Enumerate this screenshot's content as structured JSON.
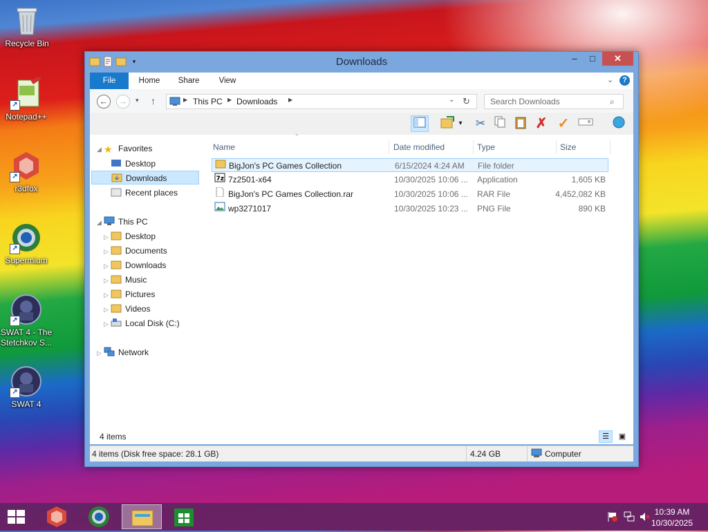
{
  "desktop": {
    "icons": [
      {
        "label": "Recycle Bin"
      },
      {
        "label": "Notepad++"
      },
      {
        "label": "r3dfox"
      },
      {
        "label": "Supermium"
      },
      {
        "label": "SWAT 4 - The Stetchkov S..."
      },
      {
        "label": "SWAT 4"
      }
    ]
  },
  "window": {
    "title": "Downloads",
    "buttons": {
      "minimize": "–",
      "maximize": "□",
      "close": "✕"
    }
  },
  "ribbon": {
    "tabs": [
      "File",
      "Home",
      "Share",
      "View"
    ]
  },
  "address": {
    "crumbs": [
      "This PC",
      "Downloads"
    ],
    "search_placeholder": "Search Downloads"
  },
  "nav": {
    "favorites_label": "Favorites",
    "favorites": [
      "Desktop",
      "Downloads",
      "Recent places"
    ],
    "thispc_label": "This PC",
    "thispc": [
      "Desktop",
      "Documents",
      "Downloads",
      "Music",
      "Pictures",
      "Videos",
      "Local Disk (C:)"
    ],
    "network_label": "Network"
  },
  "columns": [
    "Name",
    "Date modified",
    "Type",
    "Size"
  ],
  "files": [
    {
      "name": "BigJon's PC Games Collection",
      "date": "6/15/2024 4:24 AM",
      "type": "File folder",
      "size": "",
      "icon": "folder-icon"
    },
    {
      "name": "7z2501-x64",
      "date": "10/30/2025 10:06 ...",
      "type": "Application",
      "size": "1,605 KB",
      "icon": "7zip-app-icon"
    },
    {
      "name": "BigJon's PC Games Collection.rar",
      "date": "10/30/2025 10:06 ...",
      "type": "RAR File",
      "size": "4,452,082 KB",
      "icon": "file-icon"
    },
    {
      "name": "wp3271017",
      "date": "10/30/2025 10:23 ...",
      "type": "PNG File",
      "size": "890 KB",
      "icon": "image-file-icon"
    }
  ],
  "status": {
    "items_count": "4 items",
    "left": "4 items (Disk free space: 28.1 GB)",
    "size": "4.24 GB",
    "location": "Computer"
  },
  "taskbar": {
    "time": "10:39 AM",
    "date": "10/30/2025"
  },
  "colors": {
    "file_tab": "#1979ca",
    "selection": "#cce8ff",
    "title_bar": "#7aa7dd",
    "close": "#c75050"
  }
}
